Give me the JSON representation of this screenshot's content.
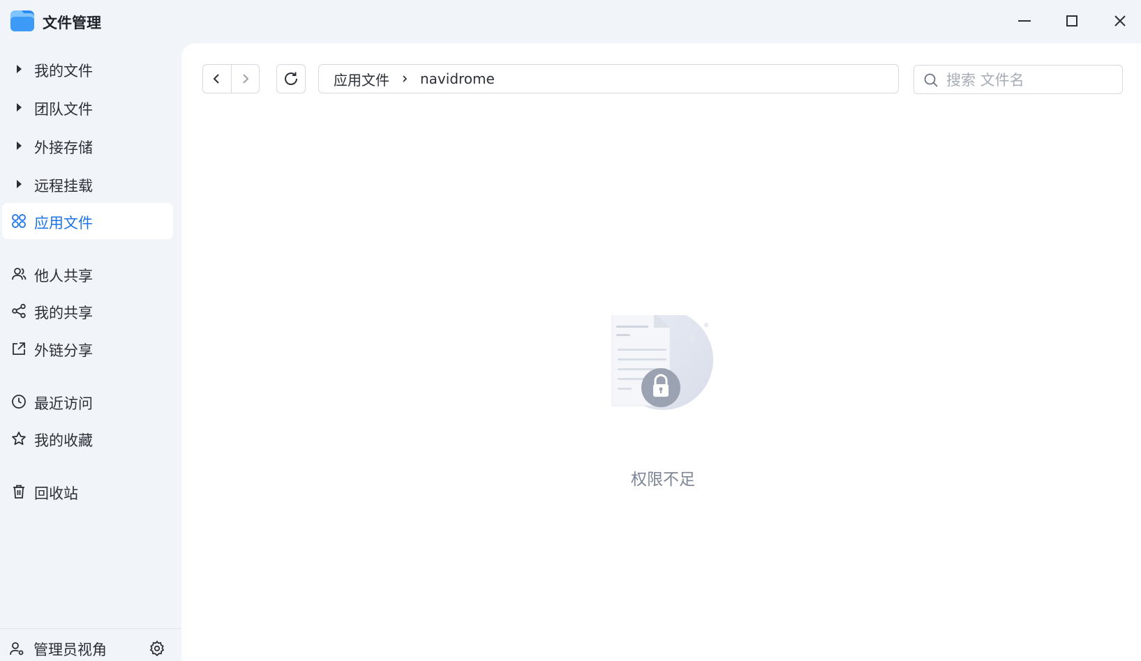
{
  "app": {
    "title": "文件管理"
  },
  "window_controls": {
    "minimize_icon": "minimize-icon",
    "maximize_icon": "maximize-icon",
    "close_icon": "close-icon"
  },
  "sidebar": {
    "items": [
      {
        "label": "我的文件",
        "icon": "caret-right-icon"
      },
      {
        "label": "团队文件",
        "icon": "caret-right-icon"
      },
      {
        "label": "外接存储",
        "icon": "caret-right-icon"
      },
      {
        "label": "远程挂载",
        "icon": "caret-right-icon"
      },
      {
        "label": "应用文件",
        "icon": "apps-grid-icon",
        "active": true
      },
      {
        "label": "他人共享",
        "icon": "users-icon"
      },
      {
        "label": "我的共享",
        "icon": "share-icon"
      },
      {
        "label": "外链分享",
        "icon": "external-link-icon"
      },
      {
        "label": "最近访问",
        "icon": "clock-icon"
      },
      {
        "label": "我的收藏",
        "icon": "star-icon"
      },
      {
        "label": "回收站",
        "icon": "trash-icon"
      }
    ],
    "footer": {
      "admin_label": "管理员视角",
      "settings_icon": "gear-icon"
    }
  },
  "toolbar": {
    "breadcrumb": [
      "应用文件",
      "navidrome"
    ],
    "search_placeholder": "搜索 文件名"
  },
  "main": {
    "empty_state_text": "权限不足",
    "empty_state_icon": "locked-document-icon"
  },
  "colors": {
    "accent": "#1a73e8",
    "sidebar_bg": "#f1f4f9",
    "panel_bg": "#ffffff",
    "muted_text": "#7c8696"
  }
}
